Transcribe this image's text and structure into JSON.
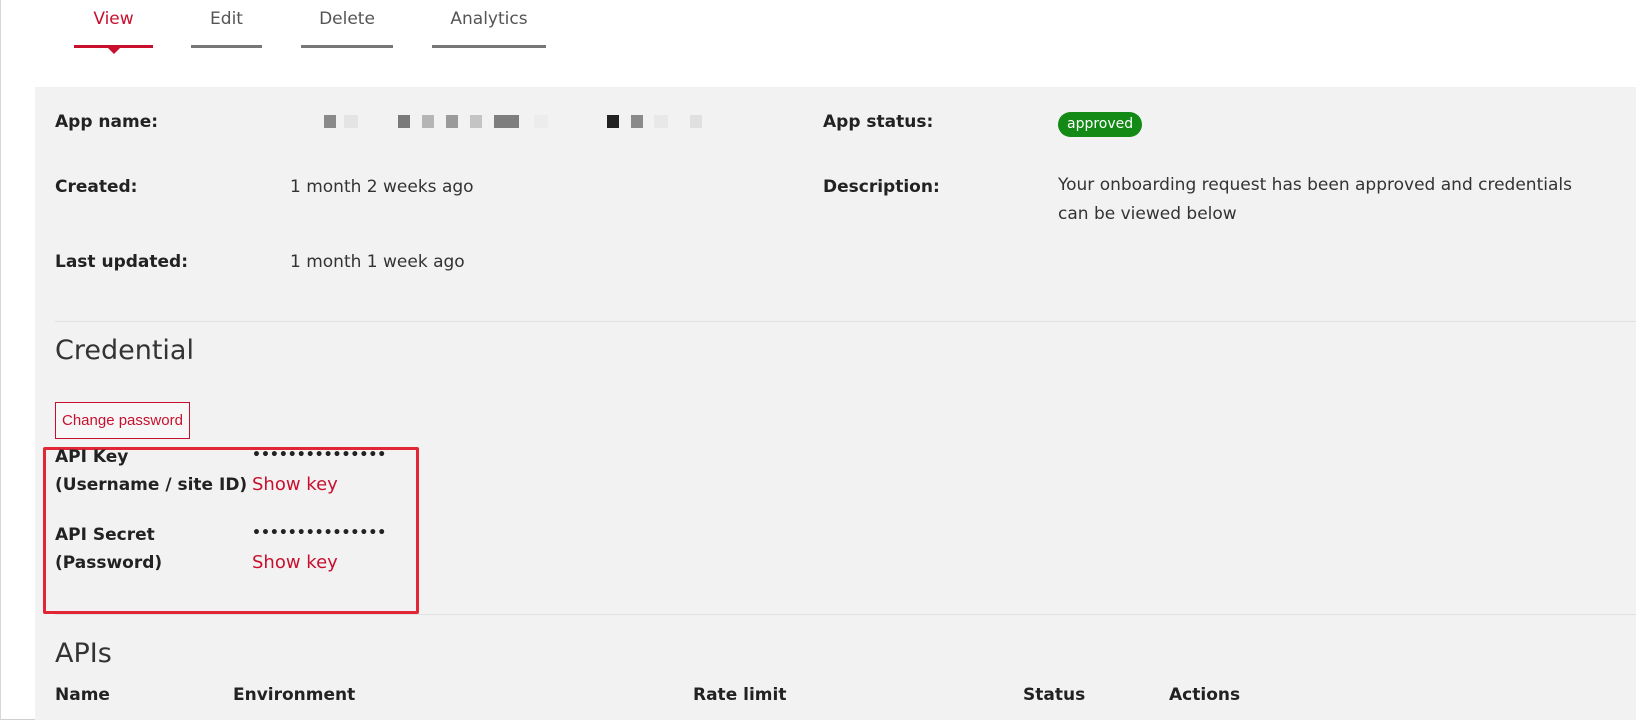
{
  "tabs": [
    {
      "label": "View",
      "active": true
    },
    {
      "label": "Edit",
      "active": false
    },
    {
      "label": "Delete",
      "active": false
    },
    {
      "label": "Analytics",
      "active": false
    }
  ],
  "details": {
    "app_name_label": "App name:",
    "app_status_label": "App status:",
    "app_status_value": "approved",
    "created_label": "Created:",
    "created_value": "1 month 2 weeks ago",
    "description_label": "Description:",
    "description_value": "Your onboarding request has been approved and credentials can be viewed below",
    "last_updated_label": "Last updated:",
    "last_updated_value": "1 month 1 week ago"
  },
  "credential": {
    "title": "Credential",
    "change_password_label": "Change password",
    "api_key_label_line1": "API Key",
    "api_key_label_line2": "(Username / site ID)",
    "api_key_masked": "•••••••••••••••",
    "api_key_show": "Show key",
    "api_secret_label_line1": "API Secret",
    "api_secret_label_line2": "(Password)",
    "api_secret_masked": "•••••••••••••••",
    "api_secret_show": "Show key"
  },
  "apis": {
    "title": "APIs",
    "columns": [
      "Name",
      "Environment",
      "Rate limit",
      "Status",
      "Actions"
    ]
  },
  "colors": {
    "accent": "#c8102e",
    "approved_badge": "#128a15",
    "highlight_border": "#e32636"
  }
}
